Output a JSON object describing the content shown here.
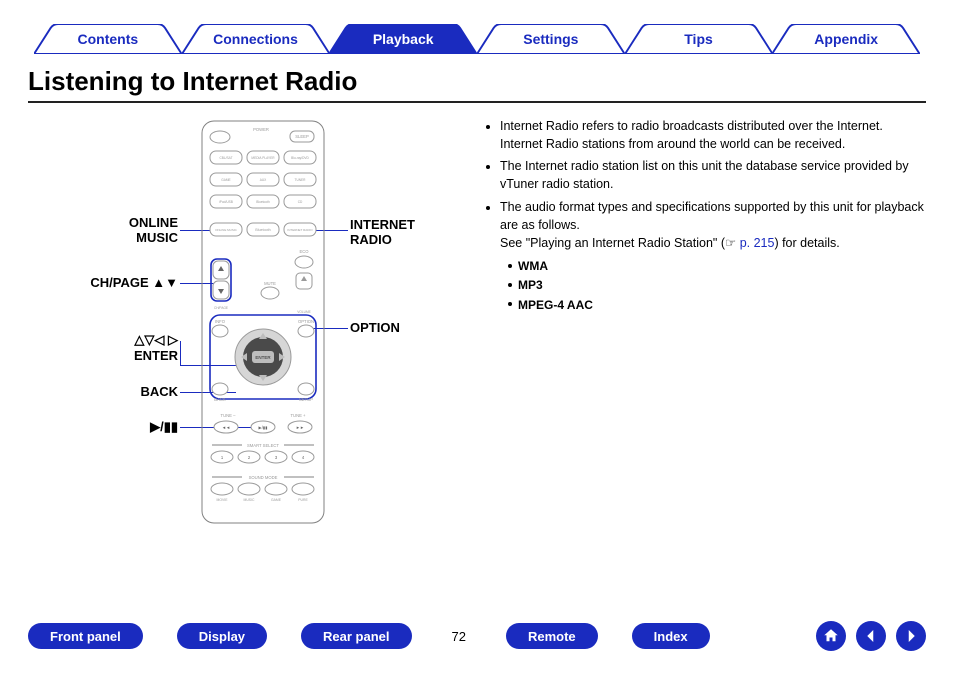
{
  "tabs": [
    {
      "label": "Contents",
      "active": false
    },
    {
      "label": "Connections",
      "active": false
    },
    {
      "label": "Playback",
      "active": true
    },
    {
      "label": "Settings",
      "active": false
    },
    {
      "label": "Tips",
      "active": false
    },
    {
      "label": "Appendix",
      "active": false
    }
  ],
  "heading": "Listening to Internet Radio",
  "callouts": {
    "online_music": "ONLINE\nMUSIC",
    "internet_radio": "INTERNET\nRADIO",
    "ch_page": "CH/PAGE ▲▼",
    "option": "OPTION",
    "cursor_enter": "△▽◁ ▷\nENTER",
    "back": "BACK",
    "play_pause": "▶/▮▮"
  },
  "remote": {
    "top_labels": {
      "power": "POWER",
      "sleep": "SLEEP"
    },
    "source_rows": [
      [
        "CBL/SAT",
        "MEDIA PLAYER",
        "Blu-ray/DVD"
      ],
      [
        "GAME",
        "AUX",
        "TUNER"
      ],
      [
        "iPod/USB",
        "Bluetooth",
        "CD"
      ]
    ],
    "music_row_left": "ONLINE MUSIC",
    "music_row_mid": "Bluetooth",
    "music_row_right": "INTERNET RADIO",
    "side_left": "CH/PAGE",
    "side_right_top": "ECO",
    "side_right_mid": "MUTE",
    "side_right_bot": "VOLUME",
    "nav_top_left": "INFO",
    "nav_top_right": "OPTION",
    "center": "ENTER",
    "nav_bot_left": "BACK",
    "nav_bot_right": "SETUP",
    "transport_labels": {
      "left": "TUNE –",
      "right": "TUNE +"
    },
    "smart": "SMART SELECT",
    "smart_nums": [
      "1",
      "2",
      "3",
      "4"
    ],
    "sound": "SOUND MODE",
    "sound_row": [
      "MOVIE",
      "MUSIC",
      "GAME",
      "PURE"
    ]
  },
  "body": {
    "b1": "Internet Radio refers to radio broadcasts distributed over the Internet. Internet Radio stations from around the world can be received.",
    "b2": "The Internet radio station list on this unit the database service provided by vTuner radio station.",
    "b3a": "The audio format types and specifications supported by this unit for playback are as follows.",
    "b3b_prefix": "See \"Playing an Internet Radio Station\" (",
    "b3b_link": "p. 215",
    "b3b_suffix": ") for details.",
    "formats": [
      "WMA",
      "MP3",
      "MPEG-4 AAC"
    ]
  },
  "footer": {
    "buttons": [
      "Front panel",
      "Display",
      "Rear panel"
    ],
    "page": "72",
    "buttons2": [
      "Remote",
      "Index"
    ],
    "icons": [
      "home-icon",
      "prev-icon",
      "next-icon"
    ]
  }
}
